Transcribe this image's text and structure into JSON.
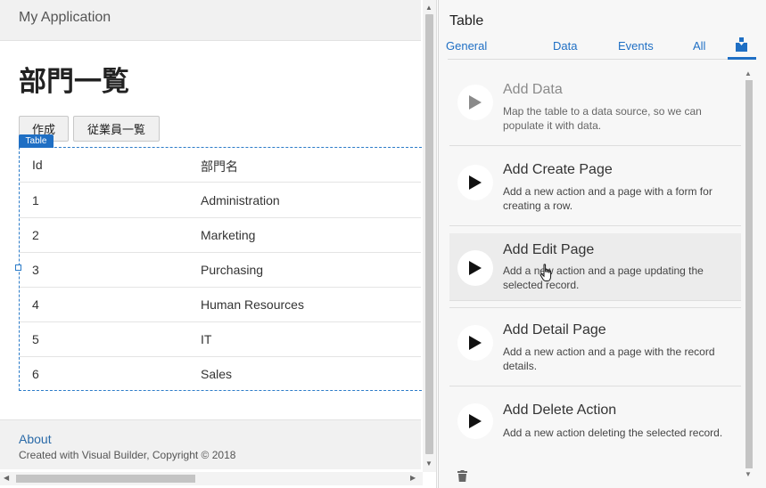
{
  "app": {
    "title": "My Application"
  },
  "page": {
    "title": "部門一覧",
    "buttons": {
      "create": "作成",
      "employees": "従業員一覧"
    }
  },
  "table": {
    "badge": "Table",
    "headers": [
      "Id",
      "部門名"
    ],
    "rows": [
      [
        "1",
        "Administration"
      ],
      [
        "2",
        "Marketing"
      ],
      [
        "3",
        "Purchasing"
      ],
      [
        "4",
        "Human Resources"
      ],
      [
        "5",
        "IT"
      ],
      [
        "6",
        "Sales"
      ]
    ]
  },
  "footer": {
    "about": "About",
    "copyright": "Created with Visual Builder, Copyright © 2018"
  },
  "panel": {
    "title": "Table",
    "tabs": [
      "General",
      "Data",
      "Events",
      "All"
    ],
    "active_tab_icon": "quick-start-icon",
    "accent_color": "#1f6fc4",
    "cards": [
      {
        "title": "Add Data",
        "desc": "Map the table to a data source, so we can populate it with data.",
        "state": "disabled"
      },
      {
        "title": "Add Create Page",
        "desc": "Add a new action and a page with a form for creating a row.",
        "state": "normal"
      },
      {
        "title": "Add Edit Page",
        "desc": "Add a new action and a page updating the selected record.",
        "state": "hover"
      },
      {
        "title": "Add Detail Page",
        "desc": "Add a new action and a page with the record details.",
        "state": "normal"
      },
      {
        "title": "Add Delete Action",
        "desc": "Add a new action deleting the selected record.",
        "state": "normal"
      }
    ]
  }
}
